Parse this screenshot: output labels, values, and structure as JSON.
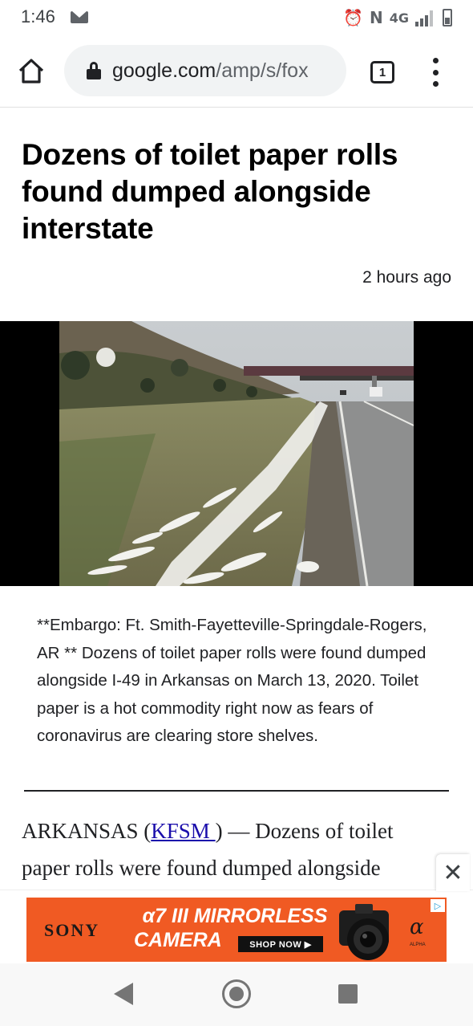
{
  "status_bar": {
    "time": "1:46",
    "network": "4G"
  },
  "browser": {
    "url_domain": "google.com",
    "url_path": "/amp/s/fox",
    "tab_count": "1"
  },
  "article": {
    "headline": "Dozens of toilet paper rolls found dumped alongside interstate",
    "timestamp": "2 hours ago",
    "caption": "**Embargo: Ft. Smith-Fayetteville-Springdale-Rogers, AR ** Dozens of toilet paper rolls were found dumped alongside I-49 in Arkansas on March 13, 2020. Toilet paper is a hot commodity right now as fears of coronavirus are clearing store shelves.",
    "body_line1_prefix": "ARKANSAS (",
    "body_link": "KFSM ",
    "body_line1_suffix": ") — Dozens of toilet",
    "body_line2": "paper rolls were found dumped alongside"
  },
  "ad": {
    "brand": "SONY",
    "headline_line1": "α7 III MIRRORLESS",
    "headline_line2": "CAMERA",
    "cta": "SHOP NOW ▶",
    "alpha_logo": "α",
    "alpha_sub": "ALPHA",
    "close_glyph": "✕",
    "choice_glyph": "▷",
    "background_color": "#f05a23"
  },
  "icons": {
    "home": "home-icon",
    "lock": "lock-icon",
    "tabs": "tab-switcher-icon",
    "menu": "overflow-menu-icon"
  }
}
